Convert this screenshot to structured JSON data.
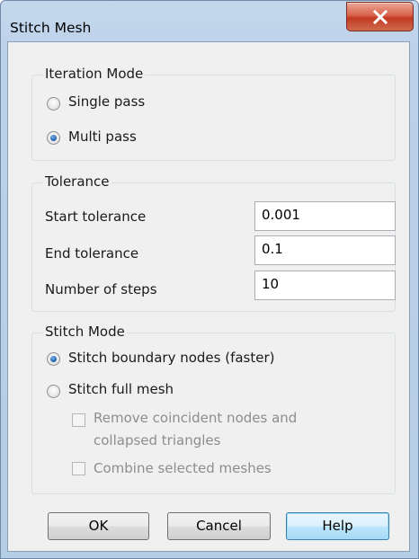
{
  "window": {
    "title": "Stitch Mesh"
  },
  "iteration_mode": {
    "label": "Iteration Mode",
    "options": [
      {
        "label": "Single pass",
        "checked": false
      },
      {
        "label": "Multi pass",
        "checked": true
      }
    ]
  },
  "tolerance": {
    "label": "Tolerance",
    "fields": [
      {
        "label": "Start tolerance",
        "value": "0.001"
      },
      {
        "label": "End tolerance",
        "value": "0.1"
      },
      {
        "label": "Number of steps",
        "value": "10"
      }
    ]
  },
  "stitch_mode": {
    "label": "Stitch Mode",
    "options": [
      {
        "label": "Stitch boundary nodes (faster)",
        "checked": true
      },
      {
        "label": "Stitch full mesh",
        "checked": false
      }
    ],
    "sub_options": [
      {
        "label_line1": "Remove coincident nodes and",
        "label_line2": "collapsed triangles",
        "checked": false,
        "enabled": false
      },
      {
        "label": "Combine selected meshes",
        "checked": false,
        "enabled": false
      }
    ]
  },
  "buttons": {
    "ok": "OK",
    "cancel": "Cancel",
    "help": "Help"
  }
}
